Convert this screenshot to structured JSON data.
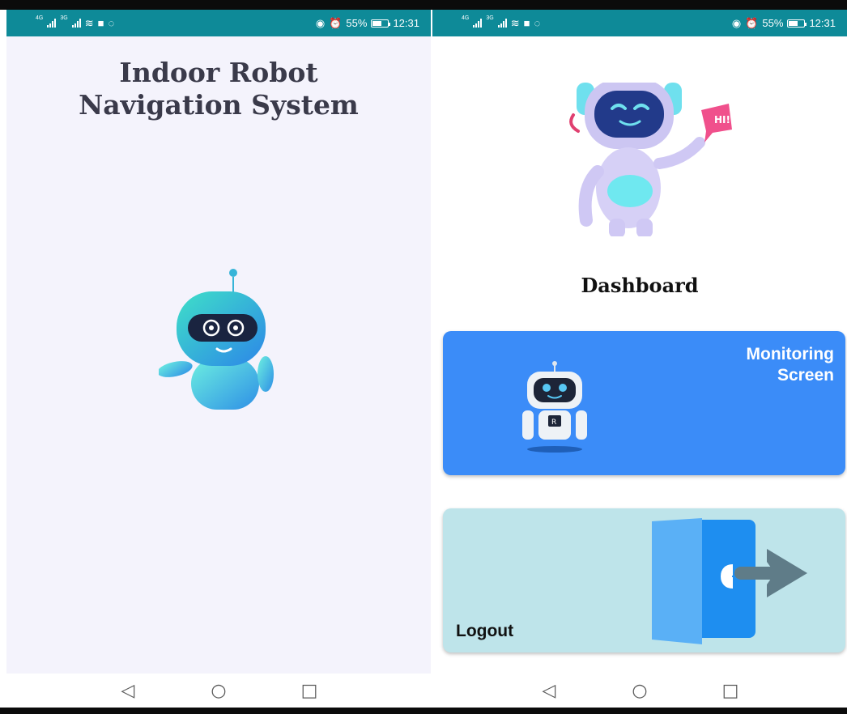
{
  "status_bar": {
    "network_small": "4G",
    "network_small_2": "3G",
    "battery": "55%",
    "time": "12:31"
  },
  "splash": {
    "title_line1": "Indoor Robot",
    "title_line2": "Navigation System",
    "robot_icon": "robot-mascot-icon"
  },
  "dashboard": {
    "title": "Dashboard",
    "robot_icon": "robot-hi-sign-icon",
    "cards": [
      {
        "label_line1": "Monitoring",
        "label_line2": "Screen",
        "icon": "monitor-robot-icon",
        "color": "#3b8cf8"
      },
      {
        "label": "Logout",
        "icon": "logout-door-icon",
        "color": "#bee4ea"
      }
    ]
  },
  "nav": {
    "back": "◁",
    "home": "○",
    "recents": "□"
  },
  "colors": {
    "status_bar": "#0e8a98",
    "splash_bg": "#f4f3fc",
    "monitor_card": "#3b8cf8",
    "logout_card": "#bee4ea"
  }
}
